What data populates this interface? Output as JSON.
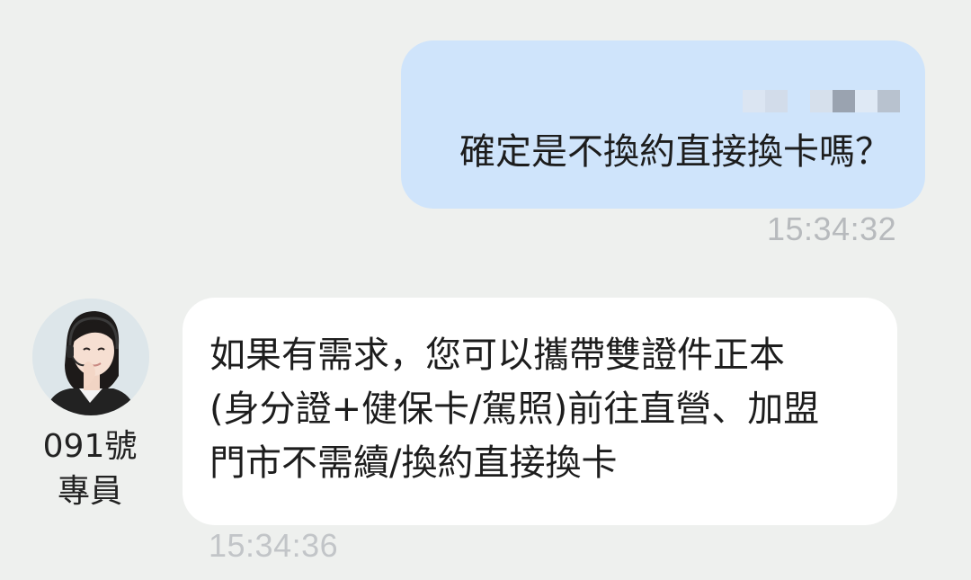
{
  "outgoing": {
    "message": "確定是不換約直接換卡嗎？",
    "time": "15:34:32",
    "bubble_color": "#cfe4fb"
  },
  "incoming": {
    "agent_name": "091號",
    "agent_title": "專員",
    "avatar": "agent-avatar-headset",
    "lines": [
      "如果有需求，您可以攜帶雙證件正本",
      "(身分證+健保卡/駕照)前往直營、加盟",
      "門市不需續/換約直接換卡"
    ],
    "time": "15:34:36",
    "bubble_color": "#ffffff"
  },
  "background_color": "#eef0ee"
}
